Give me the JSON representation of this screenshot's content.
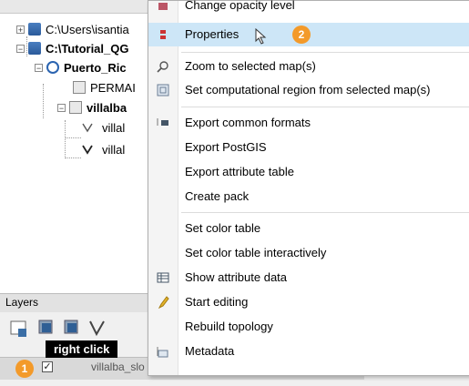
{
  "tree": {
    "items": [
      {
        "label": "C:\\Users\\isantia",
        "bold": false
      },
      {
        "label": "C:\\Tutorial_QG",
        "bold": true
      },
      {
        "label": "Puerto_Ric",
        "bold": true
      },
      {
        "label": "PERMAI",
        "bold": false
      },
      {
        "label": "villalba",
        "bold": true
      },
      {
        "label": "villal",
        "bold": false
      },
      {
        "label": "villal",
        "bold": false
      }
    ]
  },
  "menu": {
    "items": [
      {
        "label": "Change opacity level",
        "icon": "opacity-icon"
      },
      {
        "label": "Properties",
        "icon": "properties-icon",
        "highlighted": true
      },
      {
        "label": "Zoom to selected map(s)",
        "icon": "zoom-icon"
      },
      {
        "label": "Set computational region from selected map(s)",
        "icon": "region-icon"
      },
      {
        "label": "Export common formats",
        "icon": "export-icon"
      },
      {
        "label": "Export PostGIS",
        "icon": ""
      },
      {
        "label": "Export attribute table",
        "icon": ""
      },
      {
        "label": "Create pack",
        "icon": ""
      },
      {
        "label": "Set color table",
        "icon": ""
      },
      {
        "label": "Set color table interactively",
        "icon": ""
      },
      {
        "label": "Show attribute data",
        "icon": "table-icon"
      },
      {
        "label": "Start editing",
        "icon": "pencil-icon"
      },
      {
        "label": "Rebuild topology",
        "icon": ""
      },
      {
        "label": "Metadata",
        "icon": "metadata-icon"
      }
    ]
  },
  "badges": {
    "one": "1",
    "two": "2"
  },
  "layers": {
    "title": "Layers",
    "right_click_label": "right click",
    "layer_name": "villalba_slo"
  },
  "colors": {
    "highlight": "#cde6f7",
    "badge": "#f39a2a"
  }
}
